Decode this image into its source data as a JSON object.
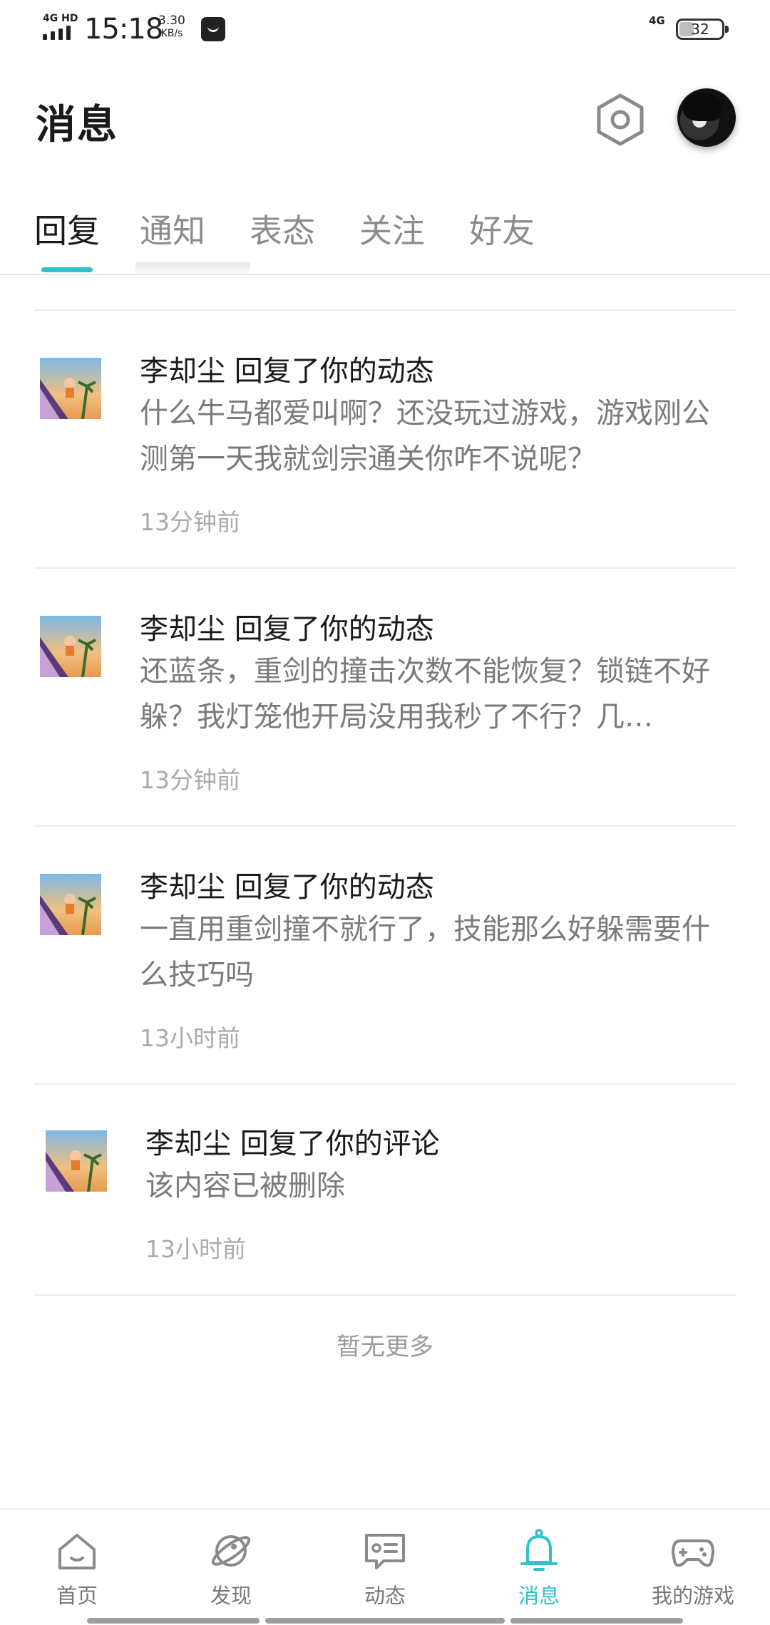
{
  "status_bar": {
    "network_left": "4G HD",
    "time": "15:18",
    "speed_value": "3.30",
    "speed_unit": "KB/s",
    "network_right": "4G",
    "battery": "32"
  },
  "header": {
    "title": "消息",
    "settings_icon": "settings-hexagon-icon",
    "avatar_icon": "user-avatar"
  },
  "tabs": [
    {
      "label": "回复",
      "active": true
    },
    {
      "label": "通知",
      "active": false
    },
    {
      "label": "表态",
      "active": false
    },
    {
      "label": "关注",
      "active": false
    },
    {
      "label": "好友",
      "active": false
    }
  ],
  "accent_color": "#2ec4cc",
  "messages": [
    {
      "title": "李却尘 回复了你的动态",
      "body": "什么牛马都爱叫啊？还没玩过游戏，游戏刚公测第一天我就剑宗通关你咋不说呢？",
      "time": "13分钟前"
    },
    {
      "title": "李却尘 回复了你的动态",
      "body": "还蓝条，重剑的撞击次数不能恢复？锁链不好躲？我灯笼他开局没用我秒了不行？几…",
      "time": "13分钟前"
    },
    {
      "title": "李却尘 回复了你的动态",
      "body": "一直用重剑撞不就行了，技能那么好躲需要什么技巧吗",
      "time": "13小时前"
    },
    {
      "title": "李却尘 回复了你的评论",
      "body": "该内容已被删除",
      "time": "13小时前"
    }
  ],
  "list_footer": "暂无更多",
  "bottom_nav": [
    {
      "label": "首页",
      "icon": "home-icon",
      "active": false
    },
    {
      "label": "发现",
      "icon": "planet-icon",
      "active": false
    },
    {
      "label": "动态",
      "icon": "chat-card-icon",
      "active": false
    },
    {
      "label": "消息",
      "icon": "bell-icon",
      "active": true
    },
    {
      "label": "我的游戏",
      "icon": "gamepad-icon",
      "active": false
    }
  ]
}
